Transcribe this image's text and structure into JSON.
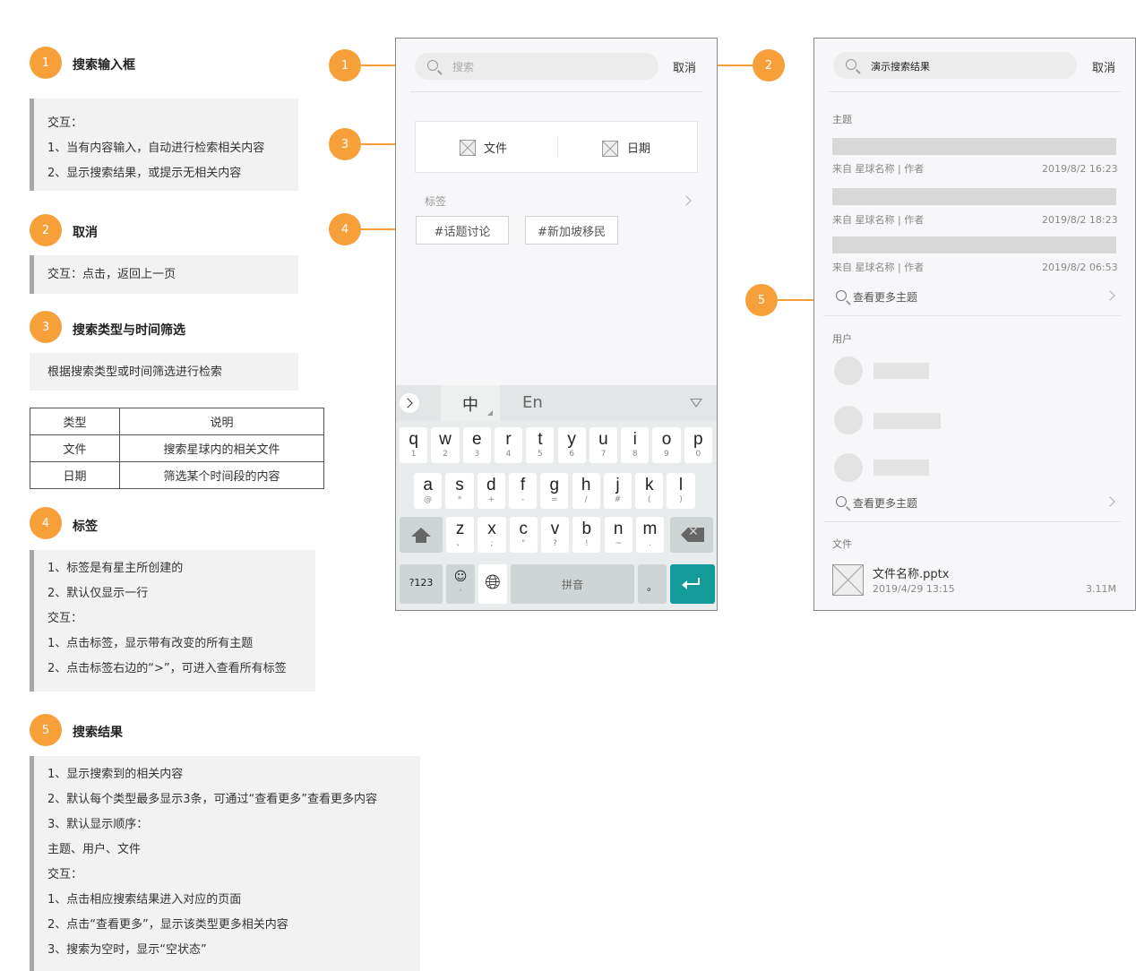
{
  "sections": [
    {
      "num": "1",
      "title": "搜索输入框",
      "lines": [
        "交互：",
        "1、当有内容输入，自动进行检索相关内容",
        "2、显示搜索结果，或提示无相关内容"
      ]
    },
    {
      "num": "2",
      "title": "取消",
      "lines": [
        "交互：点击，返回上一页"
      ]
    },
    {
      "num": "3",
      "title": "搜索类型与时间筛选",
      "lines": [
        "根据搜索类型或时间筛选进行检索"
      ]
    },
    {
      "num": "4",
      "title": "标签",
      "lines": [
        "1、标签是有星主所创建的",
        "2、默认仅显示一行",
        "交互：",
        "1、点击标签，显示带有改变的所有主题",
        "2、点击标签右边的“>”，可进入查看所有标签"
      ]
    },
    {
      "num": "5",
      "title": "搜索结果",
      "lines": [
        "1、显示搜索到的相关内容",
        "2、默认每个类型最多显示3条，可通过“查看更多”查看更多内容",
        "3、默认显示顺序：",
        "主题、用户、文件",
        "交互：",
        "1、点击相应搜索结果进入对应的页面",
        "2、点击“查看更多”，显示该类型更多相关内容",
        "3、搜索为空时，显示“空状态”"
      ]
    }
  ],
  "type_table": {
    "headers": [
      "类型",
      "说明"
    ],
    "rows": [
      [
        "文件",
        "搜索星球内的相关文件"
      ],
      [
        "日期",
        "筛选某个时间段的内容"
      ]
    ]
  },
  "callouts": [
    "1",
    "2",
    "3",
    "4",
    "5"
  ],
  "phone1": {
    "search_placeholder": "搜索",
    "cancel": "取消",
    "filters": [
      "文件",
      "日期"
    ],
    "tags_label": "标签",
    "tags": [
      "#话题讨论",
      "#新加坡移民"
    ],
    "keyboard": {
      "chinese": "中",
      "english": "En",
      "row1": [
        [
          "q",
          "1"
        ],
        [
          "w",
          "2"
        ],
        [
          "e",
          "3"
        ],
        [
          "r",
          "4"
        ],
        [
          "t",
          "5"
        ],
        [
          "y",
          "6"
        ],
        [
          "u",
          "7"
        ],
        [
          "i",
          "8"
        ],
        [
          "o",
          "9"
        ],
        [
          "p",
          "0"
        ]
      ],
      "row2": [
        [
          "a",
          "@"
        ],
        [
          "s",
          "*"
        ],
        [
          "d",
          "+"
        ],
        [
          "f",
          "-"
        ],
        [
          "g",
          "="
        ],
        [
          "h",
          "/"
        ],
        [
          "j",
          "#"
        ],
        [
          "k",
          "("
        ],
        [
          "l",
          ")"
        ]
      ],
      "row3": [
        [
          "z",
          "、"
        ],
        [
          "x",
          ";"
        ],
        [
          "c",
          "\""
        ],
        [
          "v",
          "?"
        ],
        [
          "b",
          "!"
        ],
        [
          "n",
          "~"
        ],
        [
          "m",
          "."
        ]
      ],
      "num_key": "?123",
      "space": "拼音",
      "period": "。"
    }
  },
  "phone2": {
    "search_value": "演示搜索结果",
    "cancel": "取消",
    "topics_label": "主题",
    "topic_items": [
      {
        "meta": "来自 星球名称 | 作者",
        "time": "2019/8/2 16:23"
      },
      {
        "meta": "来自 星球名称 | 作者",
        "time": "2019/8/2 18:23"
      },
      {
        "meta": "来自 星球名称 | 作者",
        "time": "2019/8/2 06:53"
      }
    ],
    "see_more_topics": "查看更多主题",
    "users_label": "用户",
    "see_more_users": "查看更多主题",
    "files_label": "文件",
    "file_name": "文件名称.pptx",
    "file_date": "2019/4/29 13:15",
    "file_size": "3.11M"
  },
  "colors": {
    "accent": "#f7a03a",
    "enter_key": "#139b99",
    "note_bg": "#f2f2f2"
  }
}
